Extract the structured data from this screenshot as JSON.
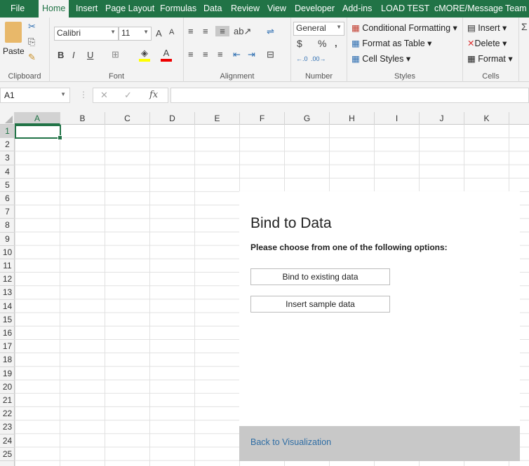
{
  "tabs": [
    "File",
    "Home",
    "Insert",
    "Page Layout",
    "Formulas",
    "Data",
    "Review",
    "View",
    "Developer",
    "Add-ins",
    "LOAD TEST",
    "cMORE/Message",
    "Team"
  ],
  "ribbon": {
    "clipboard": {
      "label": "Clipboard",
      "paste": "Paste"
    },
    "font": {
      "label": "Font",
      "name": "Calibri",
      "size": "11",
      "bold": "B",
      "italic": "I",
      "underline": "U",
      "grow": "A",
      "shrink": "A",
      "color": "A",
      "fill_color": "#ffff00",
      "font_color": "#ff0000"
    },
    "alignment": {
      "label": "Alignment"
    },
    "number": {
      "label": "Number",
      "format": "General",
      "currency": "$",
      "percent": "%",
      "comma": ","
    },
    "styles": {
      "label": "Styles",
      "conditional": "Conditional Formatting",
      "table": "Format as Table",
      "cell_styles": "Cell Styles"
    },
    "cells": {
      "label": "Cells",
      "insert": "Insert",
      "delete": "Delete",
      "format": "Format"
    },
    "editing": {
      "sum": "Σ"
    }
  },
  "formula_bar": {
    "name_box": "A1",
    "fx": "fx",
    "value": ""
  },
  "columns": [
    "A",
    "B",
    "C",
    "D",
    "E",
    "F",
    "G",
    "H",
    "I",
    "J",
    "K"
  ],
  "rows": [
    "1",
    "2",
    "3",
    "4",
    "5",
    "6",
    "7",
    "8",
    "9",
    "10",
    "11",
    "12",
    "13",
    "14",
    "15",
    "16",
    "17",
    "18",
    "19",
    "20",
    "21",
    "22",
    "23",
    "24",
    "25"
  ],
  "selected_cell": "A1",
  "panel": {
    "title": "Bind to Data",
    "prompt": "Please choose from one of the following options:",
    "bind_button": "Bind to existing data",
    "sample_button": "Insert sample data",
    "back_link": "Back to Visualization"
  },
  "colors": {
    "accent": "#217346",
    "link": "#2e6da4"
  }
}
